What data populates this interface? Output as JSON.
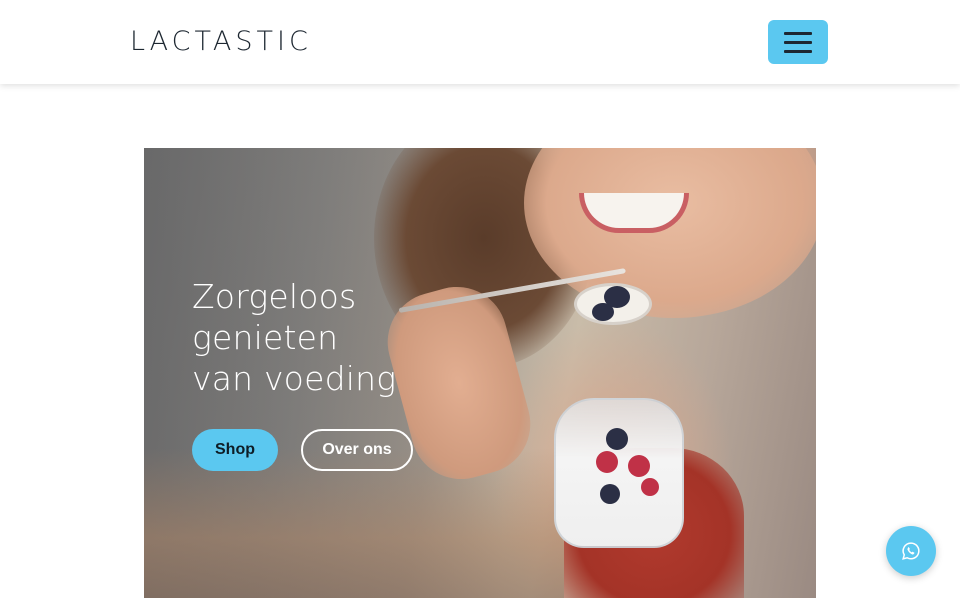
{
  "header": {
    "logo_text": "LACTASTIC",
    "menu_icon": "hamburger-menu-icon"
  },
  "hero": {
    "title_lines": [
      "Zorgeloos",
      "genieten",
      "van voeding"
    ],
    "shop_label": "Shop",
    "about_label": "Over ons",
    "image": "woman-eating-yogurt-with-berries"
  },
  "floating": {
    "whatsapp_icon": "whatsapp-icon"
  },
  "colors": {
    "accent": "#5bc8f0",
    "dark": "#1d2731",
    "white": "#ffffff"
  }
}
